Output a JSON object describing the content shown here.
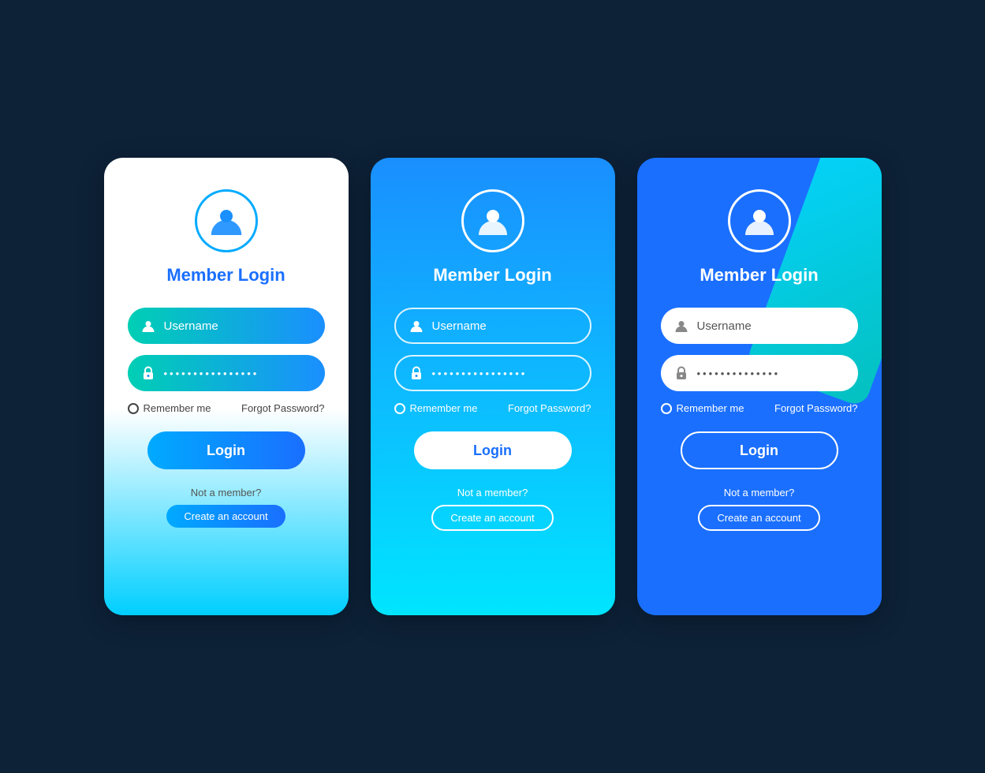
{
  "cards": [
    {
      "id": "card-1",
      "variant": "white-gradient",
      "title": "Member Login",
      "username_placeholder": "Username",
      "password_placeholder": "••••••••••••••••",
      "remember_label": "Remember me",
      "forgot_label": "Forgot Password?",
      "login_label": "Login",
      "not_member_label": "Not a member?",
      "create_label": "Create an account"
    },
    {
      "id": "card-2",
      "variant": "blue-cyan-gradient",
      "title": "Member Login",
      "username_placeholder": "Username",
      "password_placeholder": "••••••••••••••••",
      "remember_label": "Remember me",
      "forgot_label": "Forgot Password?",
      "login_label": "Login",
      "not_member_label": "Not a member?",
      "create_label": "Create an account"
    },
    {
      "id": "card-3",
      "variant": "blue-diagonal",
      "title": "Member Login",
      "username_placeholder": "Username",
      "password_placeholder": "••••••••••••••",
      "remember_label": "Remember me",
      "forgot_label": "Forgot Password?",
      "login_label": "Login",
      "not_member_label": "Not a member?",
      "create_label": "Create an account"
    }
  ]
}
